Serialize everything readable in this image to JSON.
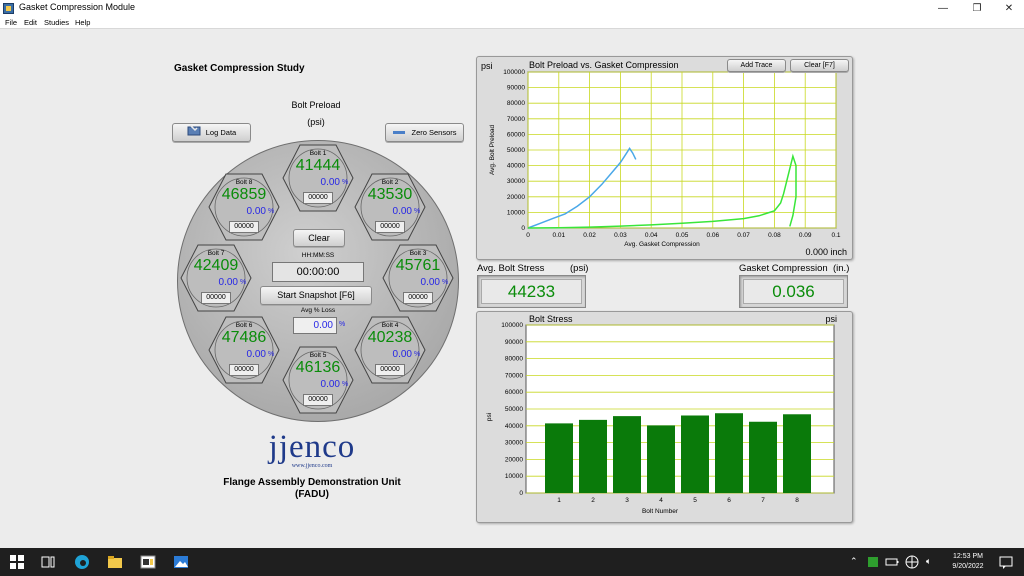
{
  "window": {
    "title": "Gasket Compression Module",
    "minimize": "—",
    "restore": "❐",
    "close": "✕"
  },
  "menu": [
    "File",
    "Edit",
    "Studies",
    "Help"
  ],
  "left": {
    "study_title": "Gasket Compression Study",
    "preload_title": "Bolt Preload",
    "preload_unit": "(psi)",
    "log_data": "Log Data",
    "zero_sensors": "Zero Sensors",
    "clear": "Clear",
    "hhmmss_label": "HH:MM:SS",
    "timer": "00:00:00",
    "snapshot": "Start Snapshot [F6]",
    "avg_loss_label": "Avg % Loss",
    "avg_loss": "0.00",
    "pct_sign": "%"
  },
  "bolts": [
    {
      "name": "Bolt 1",
      "value": "41444",
      "pct": "0.00",
      "count": "00000"
    },
    {
      "name": "Bolt 2",
      "value": "43530",
      "pct": "0.00",
      "count": "00000"
    },
    {
      "name": "Bolt 3",
      "value": "45761",
      "pct": "0.00",
      "count": "00000"
    },
    {
      "name": "Bolt 4",
      "value": "40238",
      "pct": "0.00",
      "count": "00000"
    },
    {
      "name": "Bolt 5",
      "value": "46136",
      "pct": "0.00",
      "count": "00000"
    },
    {
      "name": "Bolt 6",
      "value": "47486",
      "pct": "0.00",
      "count": "00000"
    },
    {
      "name": "Bolt 7",
      "value": "42409",
      "pct": "0.00",
      "count": "00000"
    },
    {
      "name": "Bolt 8",
      "value": "46859",
      "pct": "0.00",
      "count": "00000"
    }
  ],
  "branding": {
    "logo": "jjenco",
    "url": "www.jjenco.com",
    "unit_line1": "Flange Assembly Demonstration Unit",
    "unit_line2": "(FADU)"
  },
  "indicators": {
    "avg_stress_label": "Avg. Bolt Stress",
    "avg_stress_unit": "(psi)",
    "avg_stress": "44233",
    "gasket_label": "Gasket Compression",
    "gasket_unit": "(in.)",
    "gasket": "0.036"
  },
  "xy_chart_ui": {
    "unit": "psi",
    "add_trace": "Add Trace",
    "clear": "Clear [F7]",
    "readout": "0.000 inch"
  },
  "chart_data": [
    {
      "type": "line",
      "title": "Bolt Preload vs. Gasket Compression",
      "xlabel": "Avg. Gasket Compression",
      "ylabel": "Avg. Bolt Preload",
      "xlim": [
        0,
        0.1
      ],
      "ylim": [
        0,
        100000
      ],
      "x_ticks": [
        "0",
        "0.01",
        "0.02",
        "0.03",
        "0.04",
        "0.05",
        "0.06",
        "0.07",
        "0.08",
        "0.09",
        "0.1"
      ],
      "y_ticks": [
        "0",
        "10000",
        "20000",
        "30000",
        "40000",
        "50000",
        "60000",
        "70000",
        "80000",
        "90000",
        "100000"
      ],
      "grid": true,
      "series": [
        {
          "color": "#4aa8e8",
          "x": [
            0,
            0.004,
            0.008,
            0.012,
            0.016,
            0.02,
            0.024,
            0.027,
            0.03,
            0.032,
            0.033,
            0.034,
            0.035
          ],
          "y": [
            0,
            3000,
            6000,
            9000,
            14000,
            20000,
            28000,
            35000,
            42000,
            48000,
            51000,
            48000,
            44000
          ]
        },
        {
          "color": "#39e639",
          "x": [
            0,
            0.01,
            0.02,
            0.03,
            0.04,
            0.05,
            0.06,
            0.07,
            0.075,
            0.08,
            0.082,
            0.083,
            0.084,
            0.085,
            0.086,
            0.087,
            0.087,
            0.086,
            0.085
          ],
          "y": [
            0,
            200,
            600,
            1200,
            2000,
            3000,
            4200,
            6000,
            7800,
            11000,
            16000,
            22000,
            30000,
            38000,
            46000,
            40000,
            20000,
            8000,
            1000
          ]
        }
      ]
    },
    {
      "type": "bar",
      "title": "Bolt Stress",
      "unit": "psi",
      "xlabel": "Bolt Number",
      "ylabel": "psi",
      "categories": [
        "1",
        "2",
        "3",
        "4",
        "5",
        "6",
        "7",
        "8"
      ],
      "values": [
        41444,
        43530,
        45761,
        40238,
        46136,
        47486,
        42409,
        46859
      ],
      "ylim": [
        0,
        100000
      ],
      "y_ticks": [
        "0",
        "10000",
        "20000",
        "30000",
        "40000",
        "50000",
        "60000",
        "70000",
        "80000",
        "90000",
        "100000"
      ],
      "bar_color": "#0a7a0a",
      "grid": true
    }
  ],
  "taskbar": {
    "time": "12:53 PM",
    "date": "9/20/2022"
  }
}
